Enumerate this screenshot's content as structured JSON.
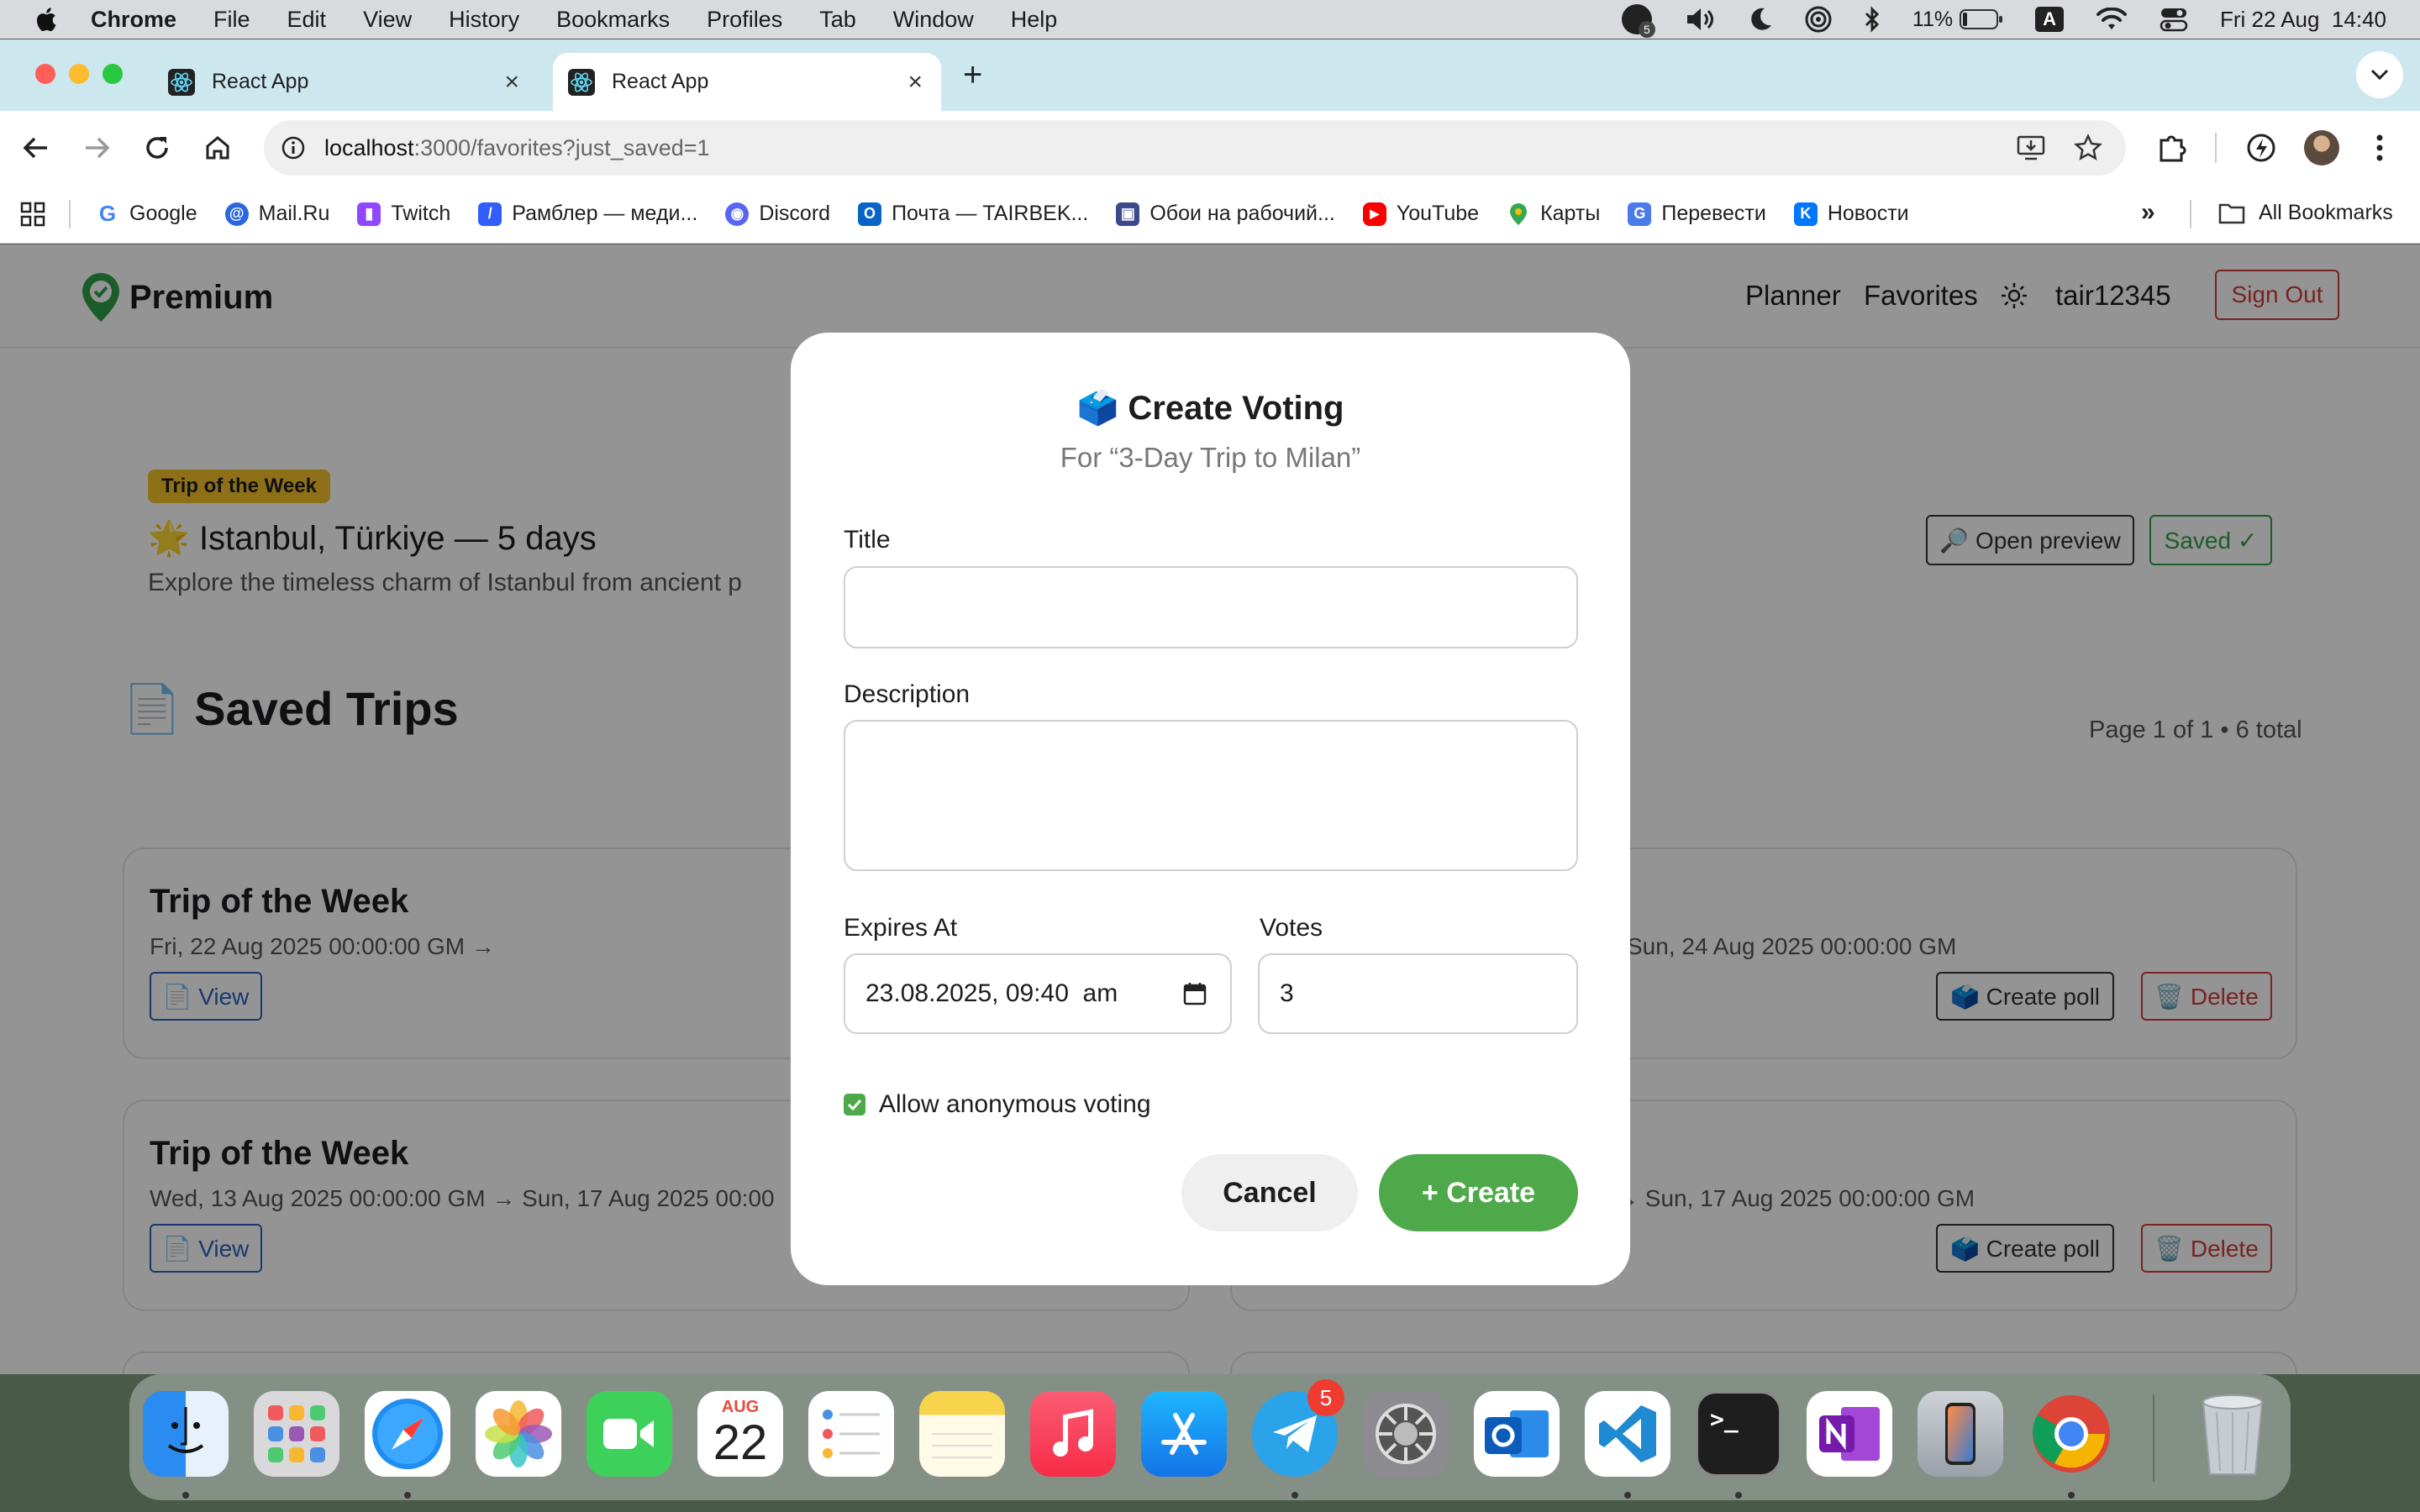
{
  "menubar": {
    "app_name": "Chrome",
    "items": [
      "File",
      "Edit",
      "View",
      "History",
      "Bookmarks",
      "Profiles",
      "Tab",
      "Window",
      "Help"
    ],
    "battery_percent": "11%",
    "input_source": "A",
    "datetime": "Fri 22 Aug  14:40",
    "badge_count": "5"
  },
  "browser": {
    "tabs": [
      {
        "title": "React App",
        "active": false
      },
      {
        "title": "React App",
        "active": true
      }
    ],
    "url_host": "localhost",
    "url_rest": ":3000/favorites?just_saved=1",
    "bookmarks": [
      "Google",
      "Mail.Ru",
      "Twitch",
      "Рамблер — меди...",
      "Discord",
      "Почта — TAIRBEK...",
      "Обои на рабочий...",
      "YouTube",
      "Карты",
      "Перевести",
      "Новости"
    ],
    "all_bookmarks": "All Bookmarks"
  },
  "app": {
    "brand": "Premium",
    "nav": {
      "planner": "Planner",
      "favorites": "Favorites",
      "username": "tair12345",
      "sign_out": "Sign Out"
    },
    "featured": {
      "badge": "Trip of the Week",
      "emoji": "🌟",
      "title": "Istanbul, Türkiye — 5 days",
      "description": "Explore the timeless charm of Istanbul from ancient p",
      "open_preview": "🔎 Open preview",
      "saved": "Saved ✓"
    },
    "saved_section": {
      "emoji": "📄",
      "heading": "Saved Trips",
      "pagination": "Page 1 of 1 • 6 total"
    },
    "cards": [
      {
        "title": "Trip of the Week",
        "dates": "Fri, 22 Aug 2025 00:00:00 GM →",
        "view": "📄 View"
      },
      {
        "title": "",
        "dates": "Sun, 24 Aug 2025 00:00:00 GM",
        "create_poll": "🗳️ Create poll",
        "delete": "🗑️ Delete"
      },
      {
        "title": "Trip of the Week",
        "dates": "Wed, 13 Aug 2025 00:00:00 GM → Sun, 17 Aug 2025 00:00",
        "view": "📄 View"
      },
      {
        "title": "",
        "dates": "→ Sun, 17 Aug 2025 00:00:00 GM",
        "create_poll": "🗳️ Create poll",
        "delete": "🗑️ Delete"
      }
    ]
  },
  "modal": {
    "emoji": "🗳️",
    "title": "Create Voting",
    "subtitle": "For “3-Day Trip to Milan”",
    "title_label": "Title",
    "title_value": "",
    "description_label": "Description",
    "description_value": "",
    "expires_label": "Expires At",
    "expires_value": "23.08.2025, 09:40  am",
    "votes_label": "Votes",
    "votes_value": "3",
    "anonymous_label": "Allow anonymous voting",
    "anonymous_checked": true,
    "cancel": "Cancel",
    "create": "+ Create"
  },
  "dock": {
    "calendar_month": "AUG",
    "calendar_day": "22",
    "telegram_badge": "5",
    "apps": [
      "Finder",
      "Launchpad",
      "Safari",
      "Photos",
      "FaceTime",
      "Calendar",
      "Reminders",
      "Notes",
      "Music",
      "App Store",
      "Telegram",
      "System Settings",
      "Outlook",
      "VS Code",
      "Terminal",
      "OneNote",
      "iPhone Mirroring",
      "Chrome",
      "Trash"
    ]
  },
  "colors": {
    "accent_green": "#4ea94a",
    "danger_red": "#d23b3b",
    "link_blue": "#2f5fbf",
    "badge_yellow": "#f4c12c",
    "tab_strip": "#cde7ef"
  }
}
